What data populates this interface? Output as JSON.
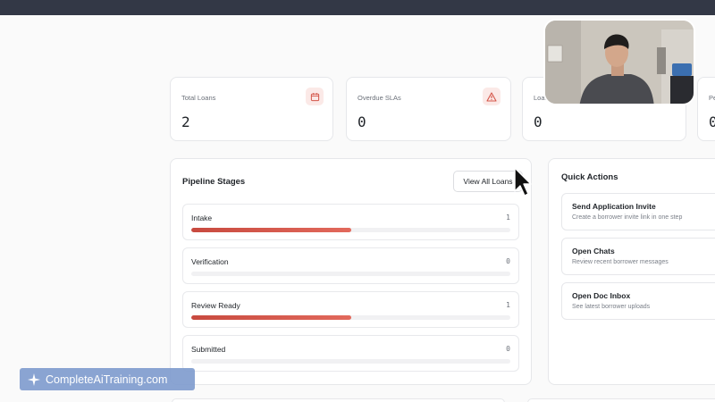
{
  "stats": [
    {
      "label": "Total Loans",
      "value": "2",
      "icon": "calendar-icon"
    },
    {
      "label": "Overdue SLAs",
      "value": "0",
      "icon": "warning-icon"
    },
    {
      "label": "Loans",
      "value": "0"
    },
    {
      "label": "Pe",
      "value": "0"
    }
  ],
  "pipeline": {
    "title": "Pipeline Stages",
    "view_all_label": "View All Loans",
    "stages": [
      {
        "name": "Intake",
        "count": "1",
        "progress": 0.5
      },
      {
        "name": "Verification",
        "count": "0",
        "progress": 0
      },
      {
        "name": "Review Ready",
        "count": "1",
        "progress": 0.5
      },
      {
        "name": "Submitted",
        "count": "0",
        "progress": 0
      }
    ]
  },
  "quick_actions": {
    "title": "Quick Actions",
    "items": [
      {
        "title": "Send Application Invite",
        "description": "Create a borrower invite link in one step"
      },
      {
        "title": "Open Chats",
        "description": "Review recent borrower messages"
      },
      {
        "title": "Open Doc Inbox",
        "description": "See latest borrower uploads"
      }
    ]
  },
  "watermark": {
    "text": "CompleteAiTraining.com"
  },
  "colors": {
    "accent": "#d4564a",
    "topbar": "#333846",
    "icon_bg": "#fbe9e7"
  }
}
